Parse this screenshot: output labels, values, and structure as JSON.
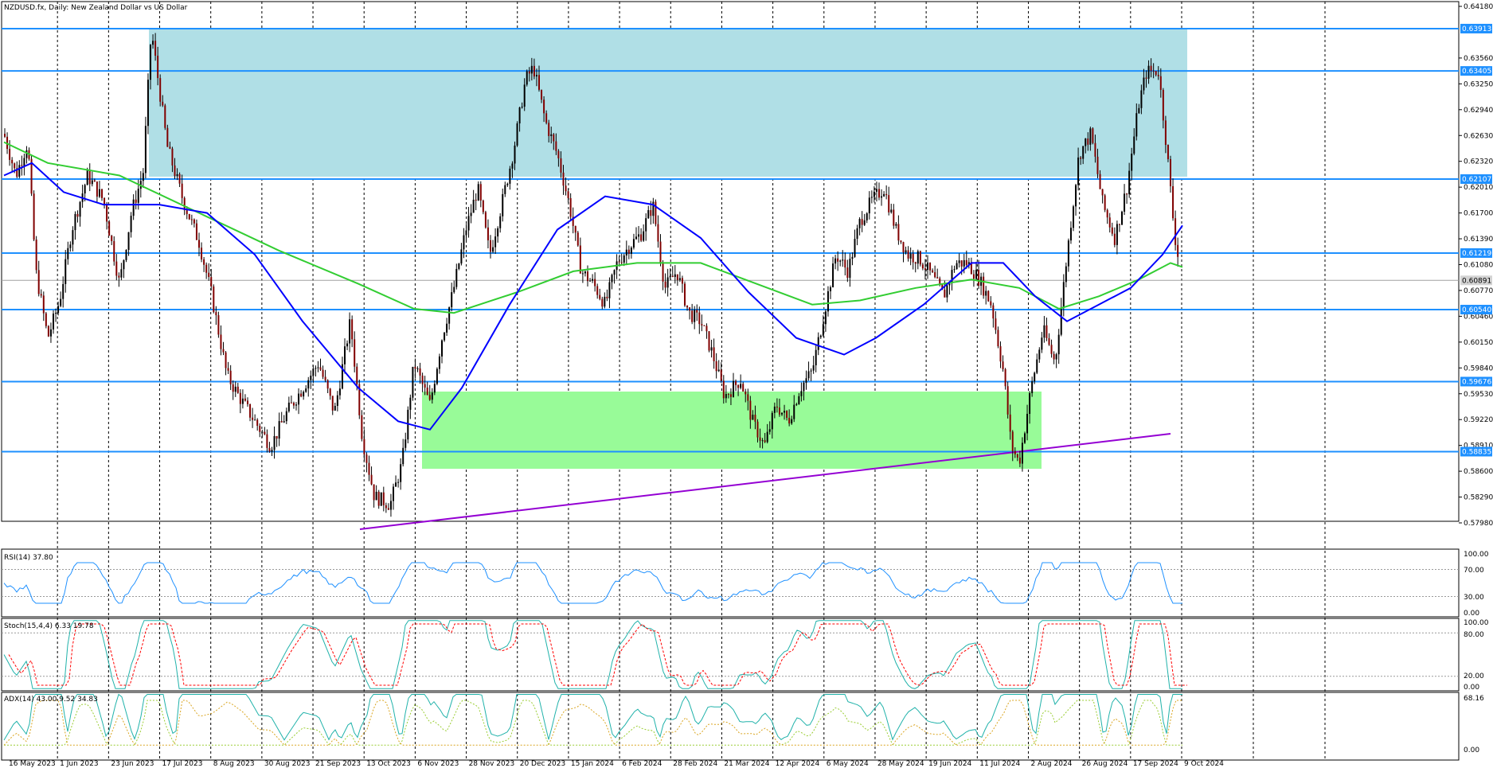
{
  "main_title": "NZDUSD.fx, Daily:  New Zealand Dollar vs US Dollar",
  "price_axis": [
    "0.64180",
    "0.63560",
    "0.63250",
    "0.62940",
    "0.62630",
    "0.62320",
    "0.62010",
    "0.61700",
    "0.61390",
    "0.61080",
    "0.60770",
    "0.60460",
    "0.60150",
    "0.59840",
    "0.59530",
    "0.59220",
    "0.58910",
    "0.58600",
    "0.58290",
    "0.57980"
  ],
  "levels": [
    {
      "value": "0.63913",
      "price": 0.63913
    },
    {
      "value": "0.63405",
      "price": 0.63405
    },
    {
      "value": "0.62107",
      "price": 0.62107
    },
    {
      "value": "0.61219",
      "price": 0.61219
    },
    {
      "value": "0.60540",
      "price": 0.6054
    },
    {
      "value": "0.59676",
      "price": 0.59676
    },
    {
      "value": "0.58835",
      "price": 0.58835
    }
  ],
  "current_price": {
    "value": "0.60891",
    "price": 0.60891
  },
  "date_axis": [
    "16 May 2023",
    "1 Jun 2023",
    "23 Jun 2023",
    "17 Jul 2023",
    "8 Aug 2023",
    "30 Aug 2023",
    "21 Sep 2023",
    "13 Oct 2023",
    "6 Nov 2023",
    "28 Nov 2023",
    "20 Dec 2023",
    "15 Jan 2024",
    "6 Feb 2024",
    "28 Feb 2024",
    "21 Mar 2024",
    "12 Apr 2024",
    "6 May 2024",
    "28 May 2024",
    "19 Jun 2024",
    "11 Jul 2024",
    "2 Aug 2024",
    "26 Aug 2024",
    "17 Sep 2024",
    "9 Oct 2024"
  ],
  "rsi": {
    "label": "RSI(14) 37.80",
    "axis": [
      "100.00",
      "70.00",
      "30.00",
      "0.00"
    ]
  },
  "stoch": {
    "label": "Stoch(15,4,4) 6.33 19.78",
    "axis": [
      "100.00",
      "80.00",
      "20.00",
      "0.00"
    ]
  },
  "adx": {
    "label": "ADX(14) 43.00 9.52 34.83",
    "axis": [
      "68.16",
      "0.00"
    ]
  },
  "colors": {
    "resistance_zone": "#b0dfe6",
    "support_zone": "#98fb98",
    "level_line": "#1e90ff",
    "ma_fast": "#0000ff",
    "ma_slow": "#32cd32",
    "trendline": "#9400d3",
    "candle": "#800000",
    "indicator_line": "#1e90ff",
    "stoch_signal": "#ff0000",
    "adx_plus": "#9acd32",
    "adx_minus": "#f0e68c"
  }
}
